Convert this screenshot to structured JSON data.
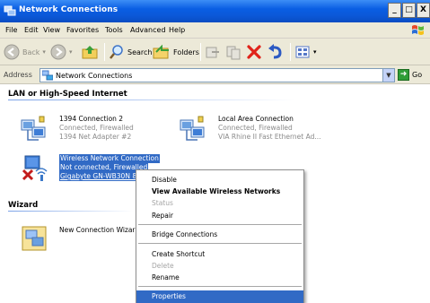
{
  "window": {
    "title": "Network Connections",
    "buttons": [
      "_",
      "□",
      "X"
    ]
  },
  "menu": [
    "File",
    "Edit",
    "View",
    "Favorites",
    "Tools",
    "Advanced",
    "Help"
  ],
  "toolbar": {
    "back_label": "Back",
    "search_label": "Search",
    "folders_label": "Folders"
  },
  "address": {
    "label": "Address",
    "value": "Network Connections",
    "go_label": "Go"
  },
  "groups": [
    {
      "header": "LAN or High-Speed Internet"
    },
    {
      "header": "Wizard"
    }
  ],
  "connections": [
    {
      "name": "1394 Connection 2",
      "status": "Connected, Firewalled",
      "device": "1394 Net Adapter #2"
    },
    {
      "name": "Local Area Connection",
      "status": "Connected, Firewalled",
      "device": "VIA Rhine II Fast Ethernet Ad..."
    },
    {
      "name": "Wireless Network Connection",
      "status": "Not connected, Firewalled",
      "device": "Gigabyte GN-WB30N 8"
    }
  ],
  "wizard": {
    "name": "New Connection Wizar"
  },
  "context_menu": {
    "items": [
      {
        "label": "Disable",
        "style": "normal"
      },
      {
        "label": "View Available Wireless Networks",
        "style": "bold"
      },
      {
        "label": "Status",
        "style": "disabled"
      },
      {
        "label": "Repair",
        "style": "normal"
      },
      {
        "label": "Bridge Connections",
        "style": "normal"
      },
      {
        "label": "Create Shortcut",
        "style": "normal"
      },
      {
        "label": "Delete",
        "style": "disabled"
      },
      {
        "label": "Rename",
        "style": "normal"
      },
      {
        "label": "Properties",
        "style": "highlighted"
      }
    ]
  },
  "colors": {
    "titlebar": "#0a5ee3",
    "selection": "#316ac5",
    "chrome": "#ece9d8"
  }
}
